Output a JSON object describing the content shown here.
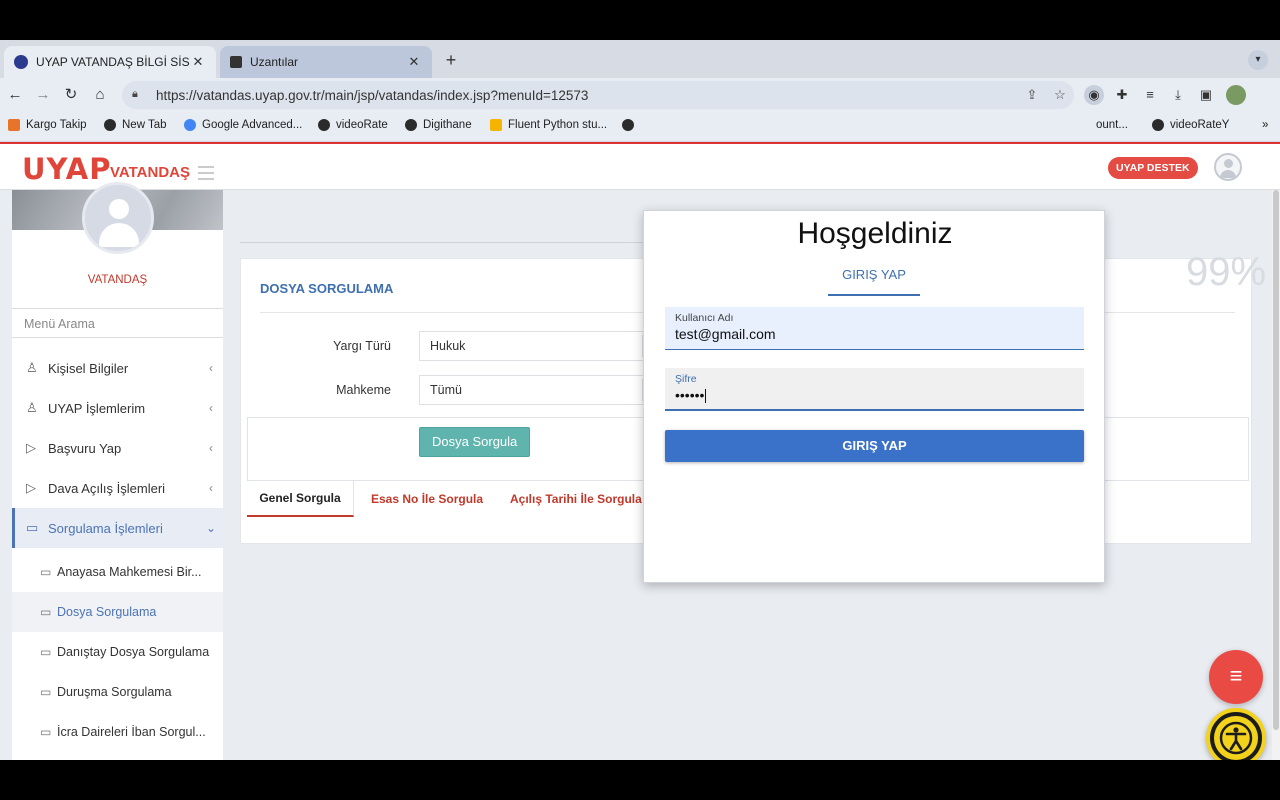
{
  "browser": {
    "tabs": [
      {
        "title": "UYAP VATANDAŞ BİLGİ SİSTEM",
        "favicon": "uyap-favicon",
        "active": true
      },
      {
        "title": "Uzantılar",
        "favicon": "puzzle-icon",
        "active": false
      }
    ],
    "url": "https://vatandas.uyap.gov.tr/main/jsp/vatandas/index.jsp?menuId=12573",
    "bookmarks": [
      {
        "label": "Kargo Takip"
      },
      {
        "label": "New Tab"
      },
      {
        "label": "Google Advanced..."
      },
      {
        "label": "videoRate"
      },
      {
        "label": "Digithane"
      },
      {
        "label": "Fluent Python stu..."
      },
      {
        "label": "ount..."
      },
      {
        "label": "videoRateY"
      }
    ]
  },
  "header": {
    "logo": "UYAP",
    "logo_sub": "VATANDAŞ",
    "support_button": "UYAP DESTEK"
  },
  "sidebar": {
    "role": "VATANDAŞ",
    "search_placeholder": "Menü Arama",
    "items": [
      {
        "label": "Kişisel Bilgiler",
        "icon": "user-outline-icon"
      },
      {
        "label": "UYAP İşlemlerim",
        "icon": "users-outline-icon"
      },
      {
        "label": "Başvuru Yap",
        "icon": "send-outline-icon"
      },
      {
        "label": "Dava Açılış İşlemleri",
        "icon": "send-outline-icon"
      },
      {
        "label": "Sorgulama İşlemleri",
        "icon": "folder-outline-icon",
        "expanded": true
      }
    ],
    "subitems": [
      {
        "label": "Anayasa Mahkemesi Bir..."
      },
      {
        "label": "Dosya Sorgulama",
        "active": true
      },
      {
        "label": "Danıştay Dosya Sorgulama"
      },
      {
        "label": "Duruşma Sorgulama"
      },
      {
        "label": "İcra Daireleri İban Sorgul..."
      }
    ]
  },
  "main": {
    "card_title": "DOSYA SORGULAMA",
    "fields": [
      {
        "label": "Yargı Türü",
        "value": "Hukuk"
      },
      {
        "label": "Mahkeme",
        "value": "Tümü"
      }
    ],
    "search_button": "Dosya Sorgula",
    "tabs": [
      "Genel Sorgula",
      "Esas No İle Sorgula",
      "Açılış Tarihi İle Sorgula"
    ],
    "percent": "99%"
  },
  "login": {
    "title": "Hoşgeldiniz",
    "tab": "GIRIŞ YAP",
    "username_label": "Kullanıcı Adı",
    "username_value": "test@gmail.com",
    "password_label": "Şifre",
    "password_value": "••••••",
    "submit": "GIRIŞ YAP"
  },
  "colors": {
    "brand_red": "#e0453a",
    "link_blue": "#3e6fb0",
    "teal_button": "#5fb5ae",
    "login_button": "#3a72c9",
    "access_yellow": "#f2d21b"
  }
}
